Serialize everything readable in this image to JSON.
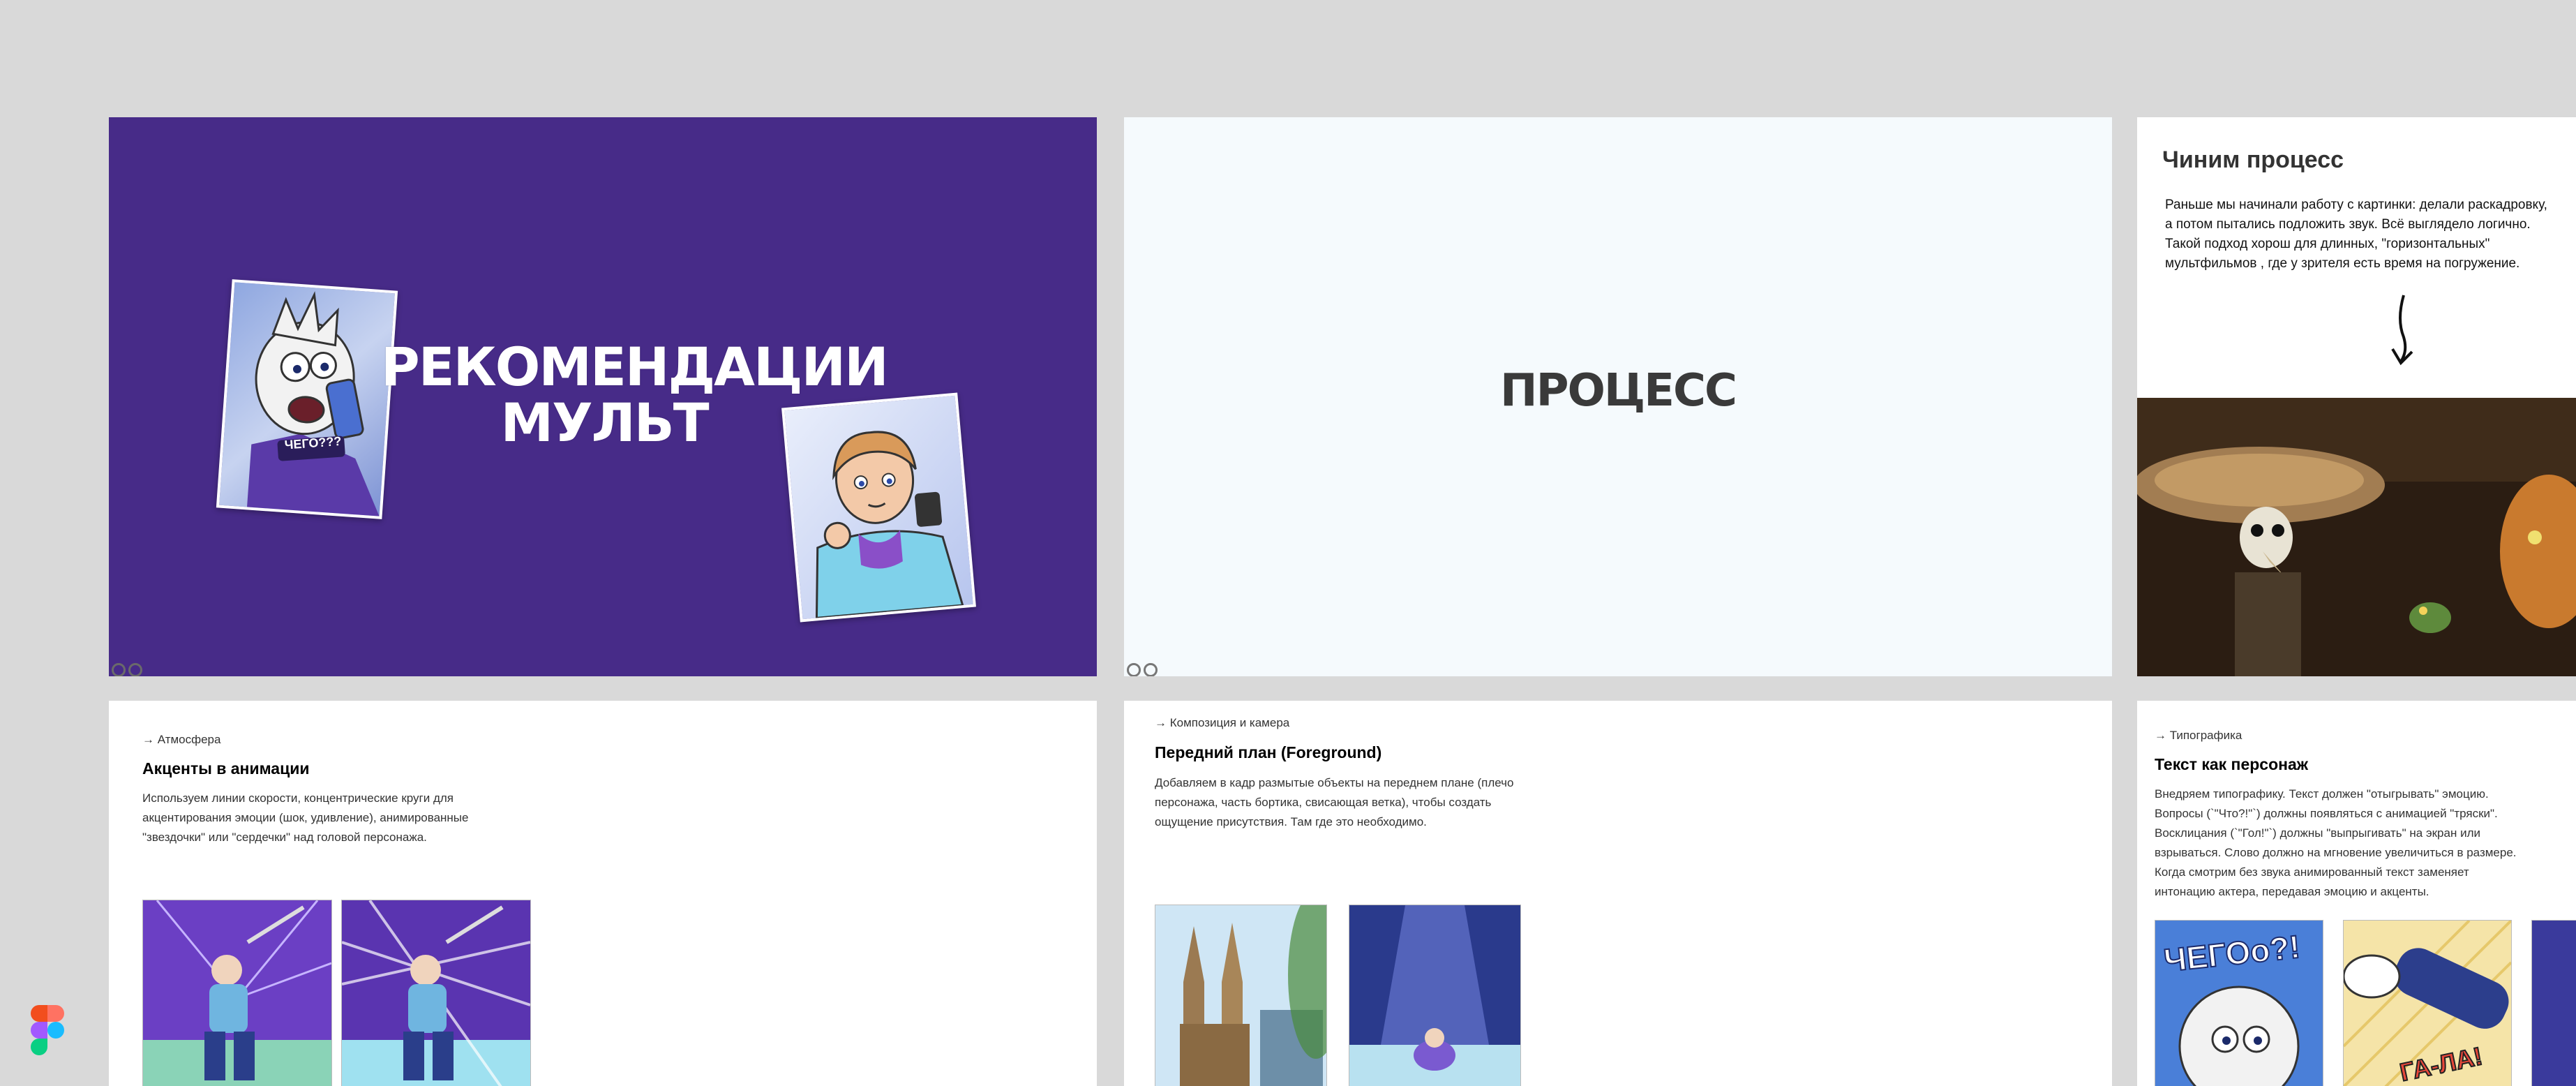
{
  "slides": {
    "title_slide": {
      "title_line1": "РЕКОМЕНДАЦИИ",
      "title_line2": "МУЛЬТ",
      "sticker_text": "ЧЕГО???"
    },
    "process_slide": {
      "title": "ПРОЦЕСС"
    },
    "fix_process": {
      "title": "Чиним процесс",
      "text": "Раньше мы начинали работу с картинки: делали раскадровку,\nа потом пытались подложить звук. Всё выглядело логично.\nТакой подход хорош для длинных, \"горизонтальных\"\nмультфильмов , где у зрителя есть время на погружение.",
      "arrow": "↓"
    },
    "accents": {
      "crumb": "→ Атмосфера",
      "heading": "Акценты в анимации",
      "text": "Используем линии скорости, концентрические круги для\nакцентирования эмоции (шок, удивление), анимированные\n\"звездочки\" или \"сердечки\" над головой персонажа."
    },
    "foreground": {
      "crumb": "→ Композиция и камера",
      "heading": "Передний план (Foreground)",
      "text": "Добавляем в кадр размытые объекты на переднем плане (плечо\nперсонажа, часть бортика, свисающая ветка), чтобы создать\nощущение присутствия. Там где это необходимо."
    },
    "typography": {
      "crumb": "→ Типографика",
      "heading": "Текст как персонаж",
      "text": "Внедряем типографику. Текст должен \"отыгрывать\" эмоцию.\nВопросы (`\"Что?!\"`) должны появляться с анимацией \"тряски\".\nВосклицания (`\"Гол!\"`) должны \"выпрыгивать\" на экран или\nвзрываться. Слово должно на мгновение увеличиться в размере.\nКогда смотрим без звука анимированный текст заменяет\nинтонацию актера, передавая эмоцию и акценты.",
      "thumb1_text": "ЧЕГОо?!",
      "thumb2_text": "ГА-ЛА!"
    }
  },
  "colors": {
    "canvas": "#d9d9d9",
    "title_slide_bg": "#472b88",
    "process_bg": "#f5fafd"
  },
  "icons": [
    "figma-logo-icon"
  ]
}
